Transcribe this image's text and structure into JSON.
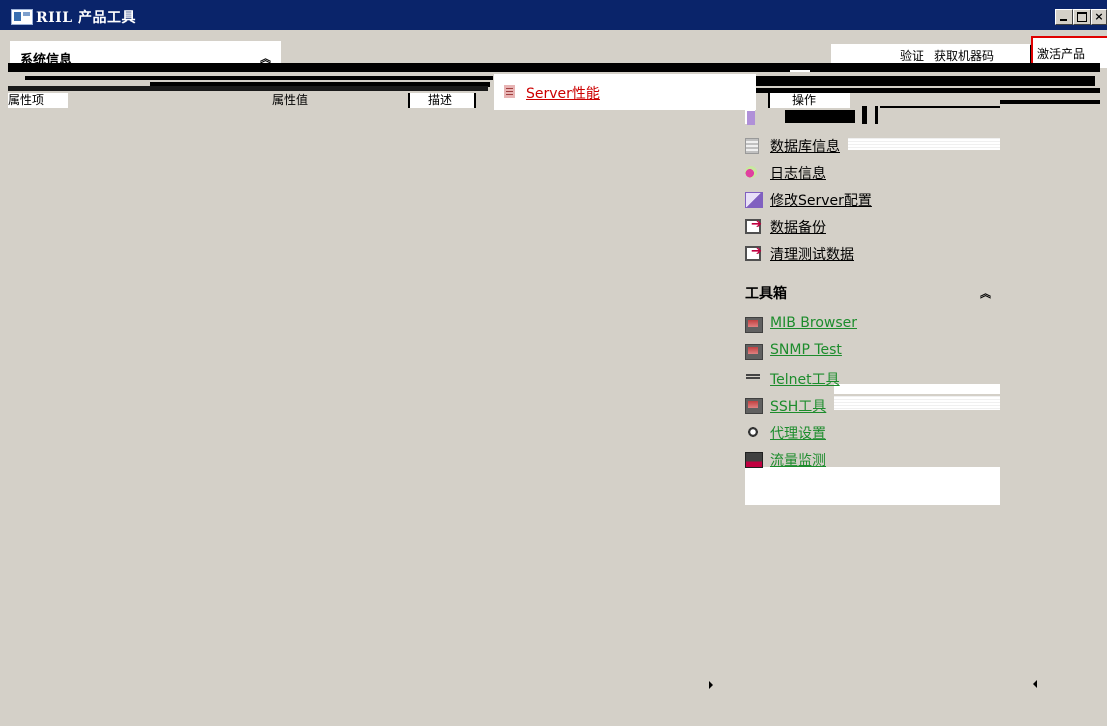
{
  "window": {
    "title": "RIIL 产品工具",
    "controls": {
      "minimize": "_",
      "maximize": "□",
      "close": "×"
    }
  },
  "sysinfo": {
    "title": "系统信息",
    "collapse_icon": "chevron-double-up"
  },
  "top_buttons": [
    {
      "label": "验证"
    },
    {
      "label": "获取机器码"
    },
    {
      "label": "激活产品"
    }
  ],
  "table_headers": [
    {
      "label": "属性项"
    },
    {
      "label": "属性值"
    },
    {
      "label": "描述"
    },
    {
      "label": "操作"
    }
  ],
  "server_tab": {
    "label": "Server性能"
  },
  "links": [
    {
      "label": "数据库信息",
      "icon": "database-icon",
      "color": "dark"
    },
    {
      "label": "日志信息",
      "icon": "log-icon",
      "color": "dark"
    },
    {
      "label": "修改Server配置",
      "icon": "edit-icon",
      "color": "dark"
    },
    {
      "label": "数据备份",
      "icon": "backup-icon",
      "color": "dark"
    },
    {
      "label": "清理测试数据",
      "icon": "backup-icon",
      "color": "dark"
    }
  ],
  "toolbox": {
    "title": "工具箱",
    "collapse_icon": "chevron-double-up",
    "items": [
      {
        "label": "MIB Browser",
        "icon": "monitor-icon"
      },
      {
        "label": "SNMP Test",
        "icon": "monitor-icon"
      },
      {
        "label": "Telnet工具",
        "icon": "telnet-icon"
      },
      {
        "label": "SSH工具",
        "icon": "monitor-icon"
      },
      {
        "label": "代理设置",
        "icon": "proxy-icon"
      },
      {
        "label": "流量监测",
        "icon": "traffic-icon"
      }
    ]
  },
  "colors": {
    "titlebar": "#0a246a",
    "background": "#d4d0c8",
    "link_green": "#1c8c2c",
    "link_red": "#cc0000",
    "active_border": "#e00000"
  }
}
